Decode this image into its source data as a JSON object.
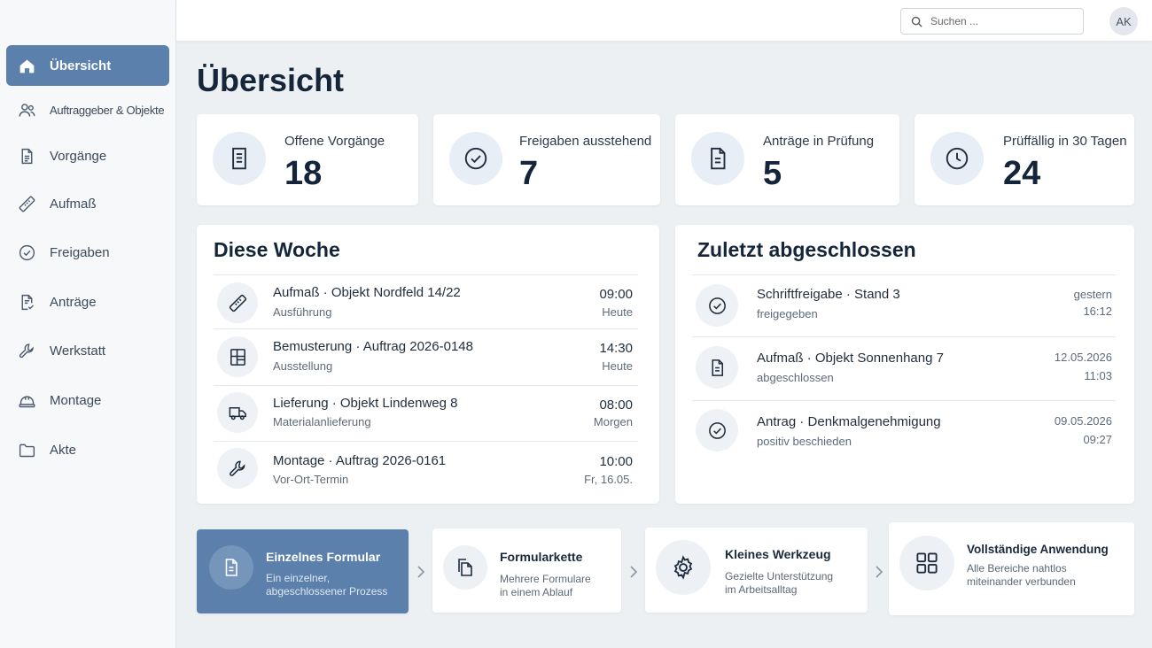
{
  "sidebar": {
    "items": [
      {
        "label": "Übersicht",
        "icon": "home-icon"
      },
      {
        "label": "Auftraggeber & Objekte",
        "icon": "users-icon"
      },
      {
        "label": "Vorgänge",
        "icon": "document-list-icon"
      },
      {
        "label": "Aufmaß",
        "icon": "ruler-icon"
      },
      {
        "label": "Freigaben",
        "icon": "check-circle-icon"
      },
      {
        "label": "Anträge",
        "icon": "document-check-icon"
      },
      {
        "label": "Werkstatt",
        "icon": "wrench-icon"
      },
      {
        "label": "Montage",
        "icon": "hardhat-icon"
      },
      {
        "label": "Akte",
        "icon": "folder-icon"
      }
    ]
  },
  "topbar": {
    "search_placeholder": "Suchen ...",
    "avatar_initials": "AK"
  },
  "page": {
    "title": "Übersicht"
  },
  "stats": [
    {
      "label": "Offene Vorgänge",
      "value": "18",
      "icon": "document-list-icon"
    },
    {
      "label": "Freigaben ausstehend",
      "value": "7",
      "icon": "check-circle-icon"
    },
    {
      "label": "Anträge in Prüfung",
      "value": "5",
      "icon": "document-icon"
    },
    {
      "label": "Prüffällig in 30 Tagen",
      "value": "24",
      "icon": "clock-icon"
    }
  ],
  "week": {
    "title": "Diese Woche",
    "items": [
      {
        "title": "Aufmaß  ·  Objekt Nordfeld 14/22",
        "sub": "Ausführung",
        "time": "09:00",
        "day": "Heute",
        "icon": "ruler-icon"
      },
      {
        "title": "Bemusterung  ·  Auftrag 2026-0148",
        "sub": "Ausstellung",
        "time": "14:30",
        "day": "Heute",
        "icon": "window-icon"
      },
      {
        "title": "Lieferung  ·  Objekt Lindenweg 8",
        "sub": "Materialanlieferung",
        "time": "08:00",
        "day": "Morgen",
        "icon": "truck-icon"
      },
      {
        "title": "Montage  ·  Auftrag 2026-0161",
        "sub": "Vor-Ort-Termin",
        "time": "10:00",
        "day": "Fr, 16.05.",
        "icon": "wrench-icon"
      }
    ]
  },
  "recent": {
    "title": "Zuletzt abgeschlossen",
    "items": [
      {
        "title": "Schriftfreigabe · Stand 3",
        "sub": "freigegeben",
        "date": "gestern",
        "time": "16:12",
        "icon": "check-circle-icon"
      },
      {
        "title": "Aufmaß  ·  Objekt Sonnenhang 7",
        "sub": "abgeschlossen",
        "date": "12.05.2026",
        "time": "11:03",
        "icon": "document-icon"
      },
      {
        "title": "Antrag  ·  Denkmalgenehmigung",
        "sub": "positiv beschieden",
        "date": "09.05.2026",
        "time": "09:27",
        "icon": "check-circle-icon"
      }
    ]
  },
  "features": [
    {
      "title": "Einzelnes Formular",
      "desc": "Ein einzelner, abgeschlossener Prozess",
      "icon": "document-icon"
    },
    {
      "title": "Formularkette",
      "desc": "Mehrere Formulare in einem Ablauf",
      "icon": "copy-icon"
    },
    {
      "title": "Kleines Werkzeug",
      "desc": "Gezielte Unterstützung im Arbeitsalltag",
      "icon": "gear-icon"
    },
    {
      "title": "Vollständige Anwendung",
      "desc": "Alle Bereiche nahtlos miteinander verbunden",
      "icon": "grid-icon"
    }
  ],
  "colors": {
    "accent": "#5a80ab",
    "background": "#edf0f3",
    "card": "#ffffff",
    "text": "#16263a"
  }
}
